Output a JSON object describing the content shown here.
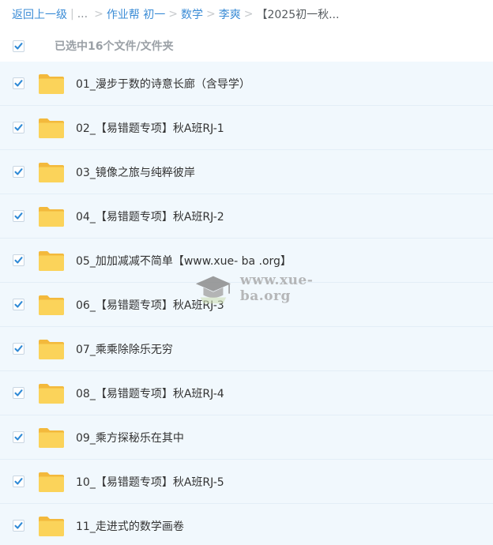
{
  "breadcrumb": {
    "back": "返回上一级",
    "ellipsis": "...",
    "items": [
      "作业帮 初一",
      "数学",
      "李爽"
    ],
    "current": "【2025初一秋..."
  },
  "selection": {
    "text": "已选中16个文件/文件夹"
  },
  "files": [
    {
      "name": "01_漫步于数的诗意长廊（含导学）"
    },
    {
      "name": "02_【易错题专项】秋A班RJ-1"
    },
    {
      "name": "03_镜像之旅与纯粹彼岸"
    },
    {
      "name": "04_【易错题专项】秋A班RJ-2"
    },
    {
      "name": "05_加加减减不简单【www.xue- ba .org】"
    },
    {
      "name": "06_【易错题专项】秋A班RJ-3"
    },
    {
      "name": "07_乘乘除除乐无穷"
    },
    {
      "name": "08_【易错题专项】秋A班RJ-4"
    },
    {
      "name": "09_乘方探秘乐在其中"
    },
    {
      "name": "10_【易错题专项】秋A班RJ-5"
    },
    {
      "name": "11_走进式的数学画卷"
    }
  ],
  "watermark": {
    "text": "www.xue-ba.org"
  },
  "colors": {
    "link": "#3b8cd6",
    "check": "#2f8ad6",
    "row_bg": "#f1f8fd",
    "folder": "#f8c94a"
  },
  "icons": {
    "checkbox": "checkmark-icon",
    "folder": "folder-icon",
    "watermark": "graduation-cap-icon"
  }
}
